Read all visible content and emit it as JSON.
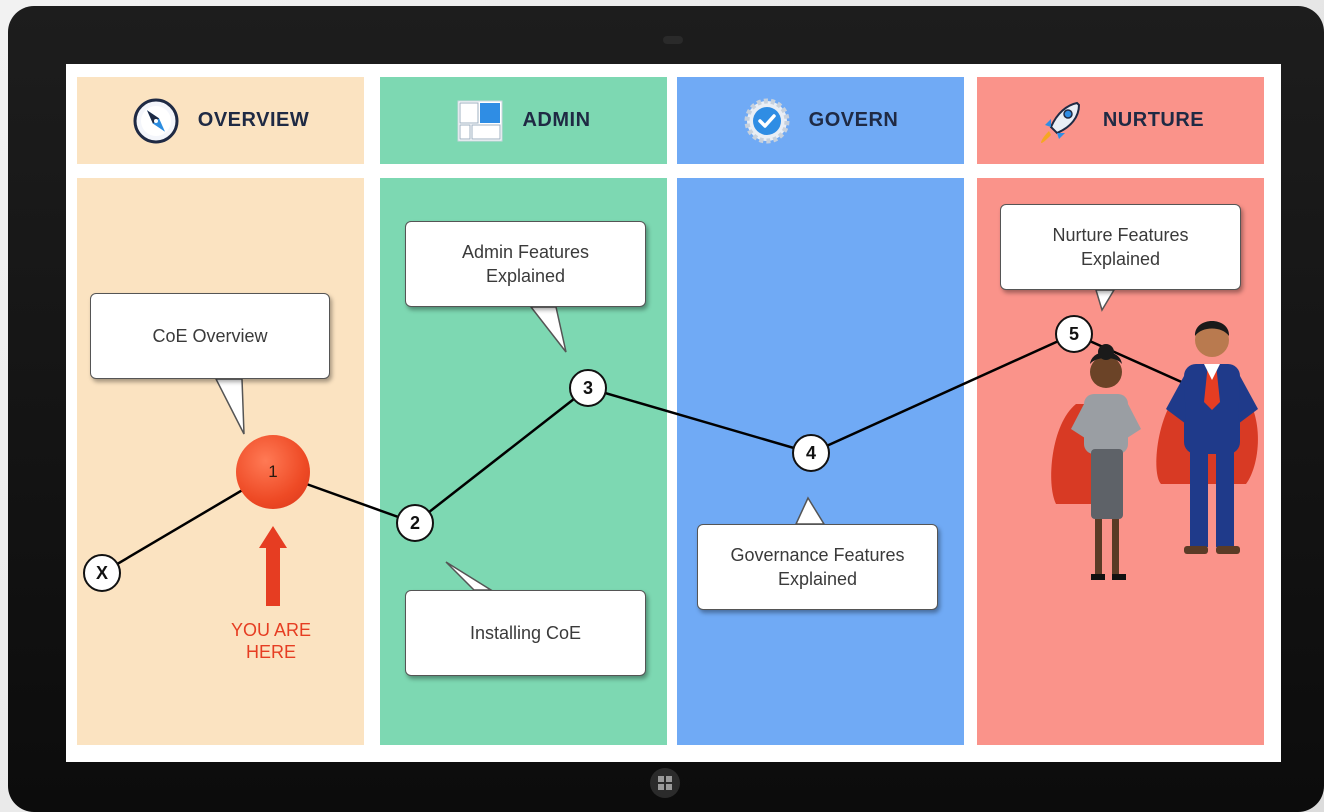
{
  "stages": [
    {
      "label": "OVERVIEW",
      "icon": "compass-icon"
    },
    {
      "label": "ADMIN",
      "icon": "layout-icon"
    },
    {
      "label": "GOVERN",
      "icon": "gear-check-icon"
    },
    {
      "label": "NURTURE",
      "icon": "rocket-icon"
    }
  ],
  "callouts": {
    "coe_overview": "CoE Overview",
    "admin_features": [
      "Admin Features",
      "Explained"
    ],
    "installing_coe": "Installing CoE",
    "governance_features": [
      "Governance Features",
      "Explained"
    ],
    "nurture_features": [
      "Nurture Features",
      "Explained"
    ]
  },
  "nodes": {
    "start": "X",
    "n1": "1",
    "n2": "2",
    "n3": "3",
    "n4": "4",
    "n5": "5"
  },
  "you_are_here": [
    "YOU ARE",
    "HERE"
  ],
  "colors": {
    "overview": "#fbe3c1",
    "admin": "#7dd8b2",
    "govern": "#70aaf5",
    "nurture": "#fa938a",
    "highlight": "#ee4a25"
  }
}
